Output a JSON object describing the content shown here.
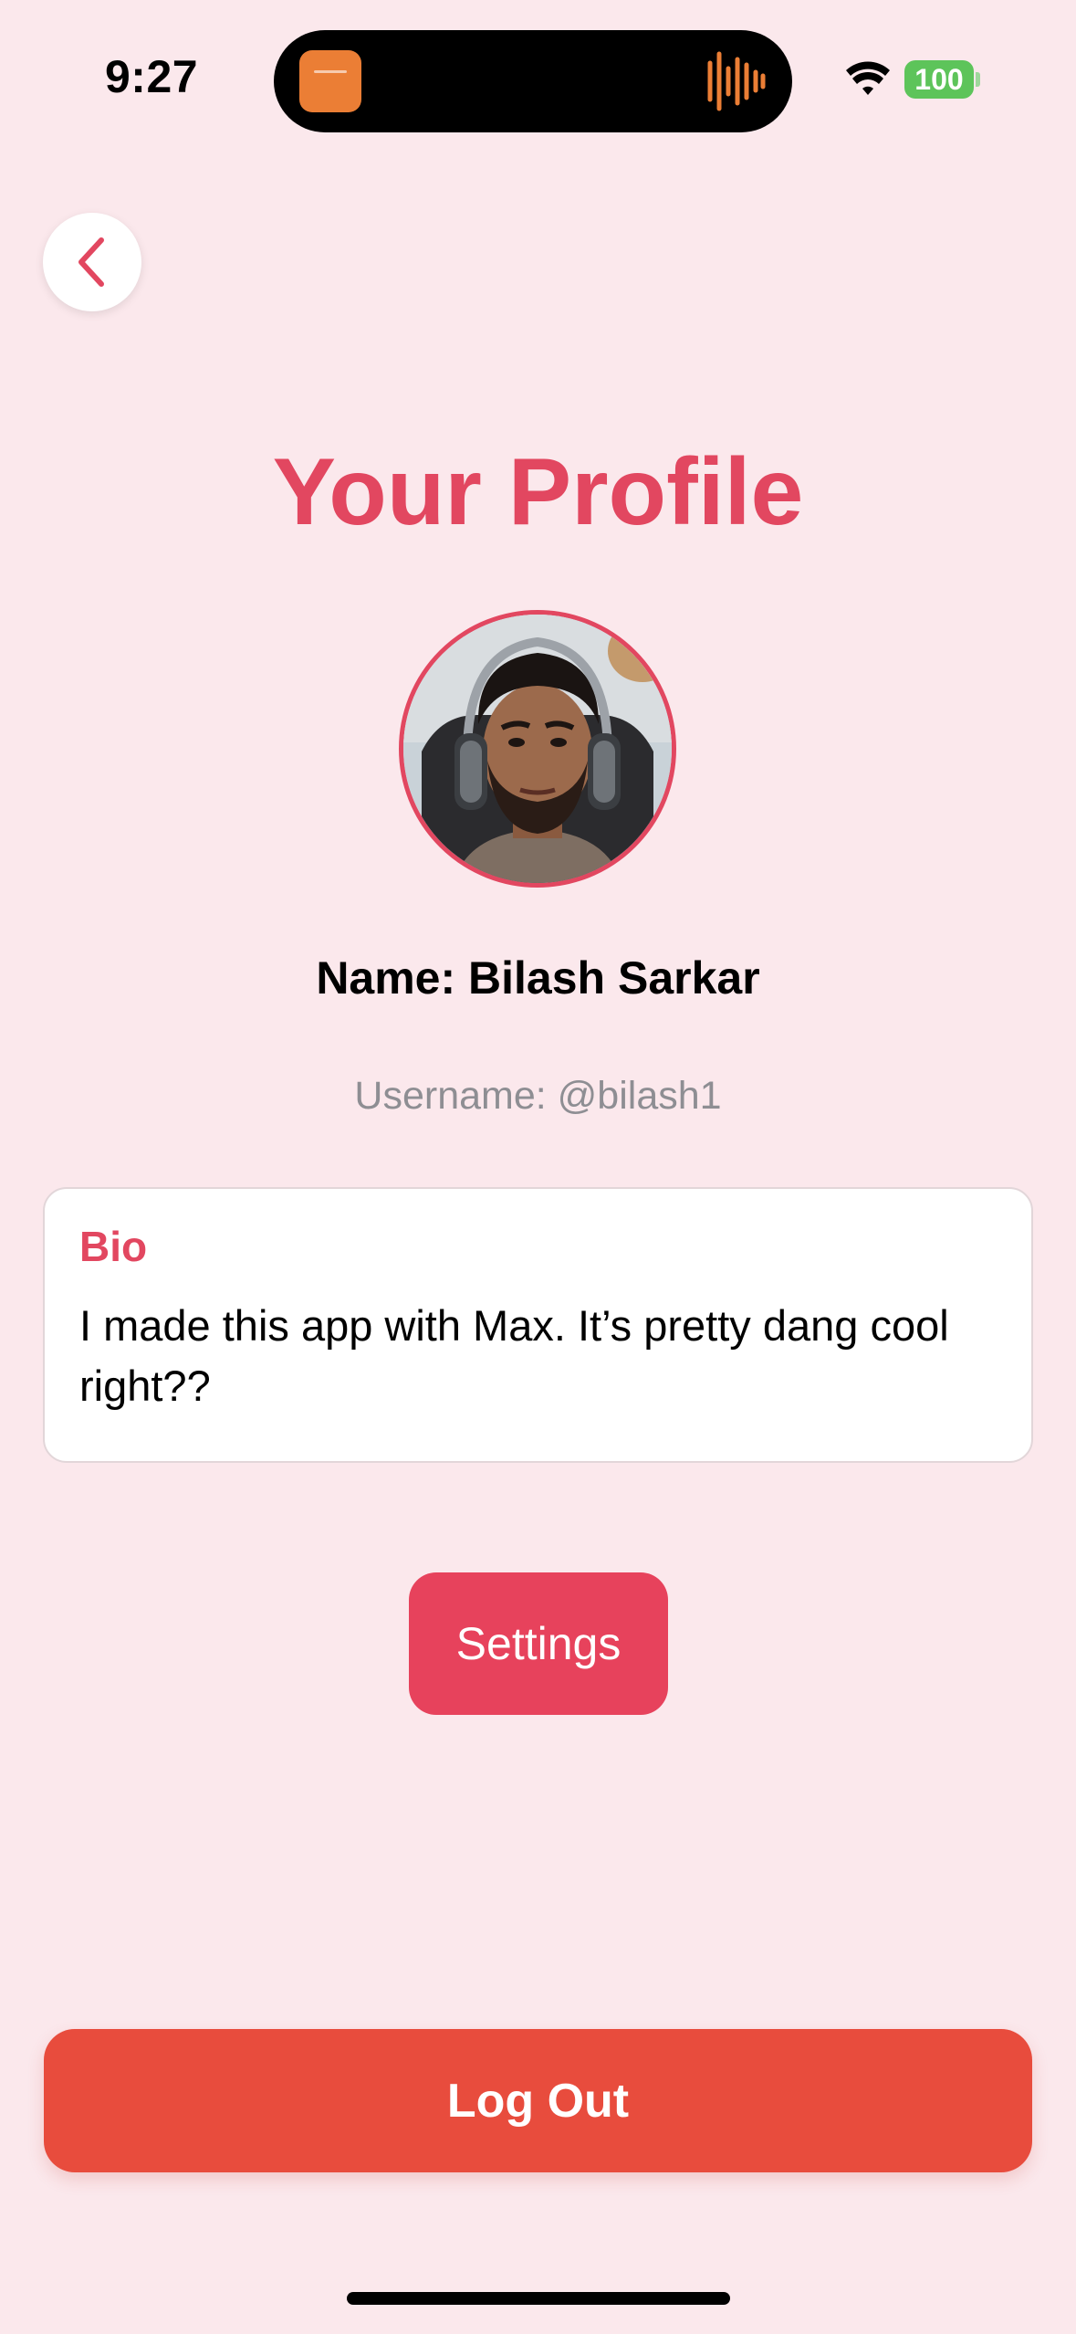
{
  "status_bar": {
    "time": "9:27",
    "battery": "100",
    "icons": [
      "wifi-icon",
      "battery-icon"
    ]
  },
  "dynamic_island": {
    "app_icon": "audio-app-icon",
    "activity_icon": "audio-waveform-icon",
    "accent": "#EB7E35"
  },
  "nav": {
    "back_icon": "chevron-left-icon"
  },
  "profile": {
    "title": "Your Profile",
    "avatar": "profile-photo",
    "name_line": "Name: Bilash Sarkar",
    "username_line": "Username: @bilash1"
  },
  "bio": {
    "label": "Bio",
    "text": "I made this app with Max. It’s pretty dang cool right??"
  },
  "actions": {
    "settings_label": "Settings",
    "logout_label": "Log Out"
  },
  "colors": {
    "background": "#FBE8EC",
    "accent": "#E24760",
    "settings": "#E7425C",
    "logout": "#E84C3D",
    "battery": "#5DC45A"
  }
}
